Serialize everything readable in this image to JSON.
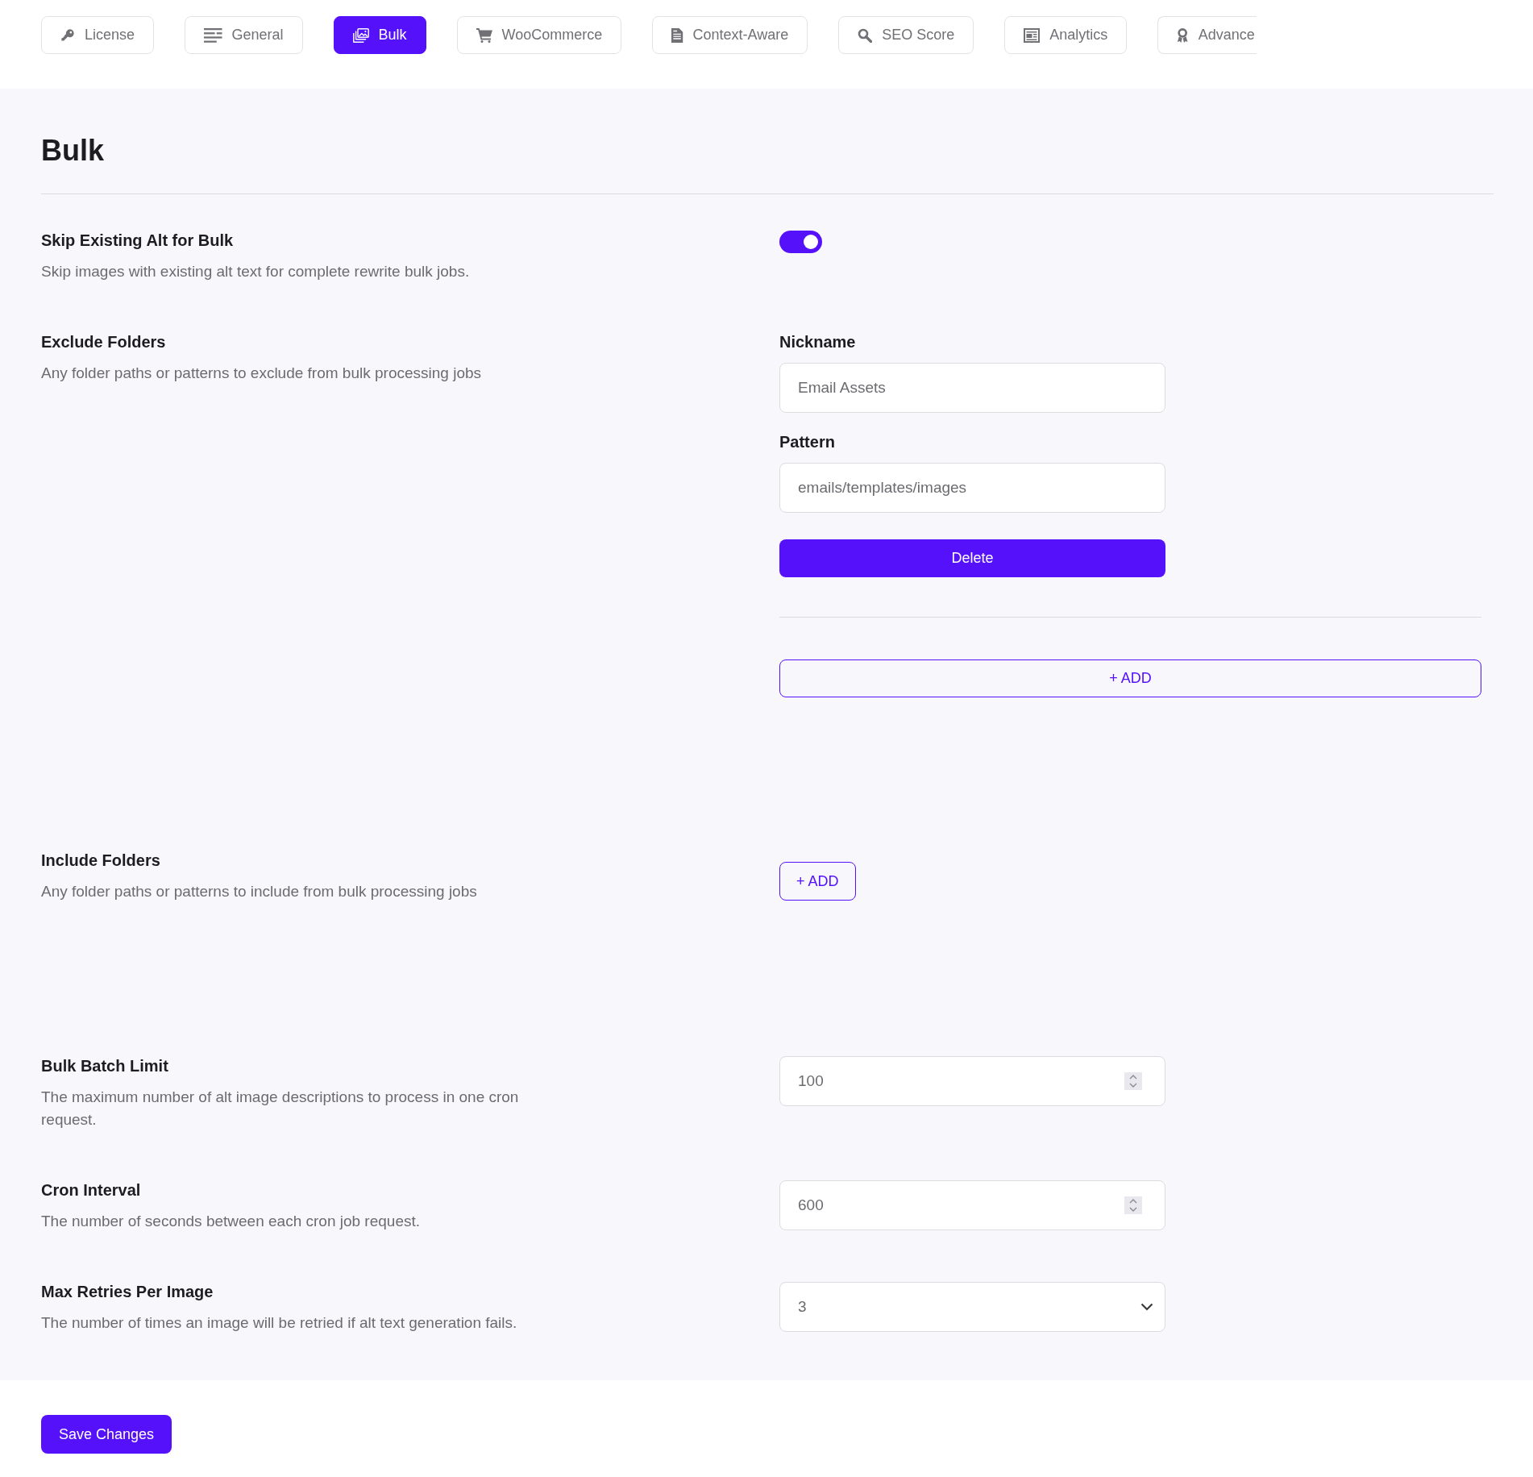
{
  "tabs": [
    {
      "label": "License",
      "selected": false
    },
    {
      "label": "General",
      "selected": false
    },
    {
      "label": "Bulk",
      "selected": true
    },
    {
      "label": "WooCommerce",
      "selected": false
    },
    {
      "label": "Context-Aware",
      "selected": false
    },
    {
      "label": "SEO Score",
      "selected": false
    },
    {
      "label": "Analytics",
      "selected": false
    },
    {
      "label": "Advance",
      "selected": false
    }
  ],
  "page": {
    "title": "Bulk"
  },
  "settings": [
    {
      "kind": "toggle",
      "title": "Skip Existing Alt for Bulk",
      "description": "Skip images with existing alt text for complete rewrite bulk jobs.",
      "on": true
    },
    {
      "kind": "folders",
      "title": "Exclude Folders",
      "description": "Any folder paths or patterns to exclude from bulk processing jobs",
      "entries": [
        {
          "fields": [
            {
              "label": "Nickname",
              "value": "Email Assets"
            },
            {
              "label": "Pattern",
              "value": "emails/templates/images"
            }
          ],
          "delete_button": "Delete"
        }
      ],
      "add_button": "+ ADD"
    },
    {
      "kind": "folders",
      "title": "Include Folders",
      "description": "Any folder paths or patterns to include from bulk processing jobs",
      "add_button": "+ ADD"
    },
    {
      "kind": "number",
      "title": "Bulk Batch Limit",
      "description": "The maximum number of alt image descriptions to process in one cron request.",
      "value": "100"
    },
    {
      "kind": "number",
      "title": "Cron Interval",
      "description": "The number of seconds between each cron job request.",
      "value": "600"
    },
    {
      "kind": "select",
      "title": "Max Retries Per Image",
      "description": "The number of times an image will be retried if alt text generation fails.",
      "value": "3"
    }
  ],
  "save_button": "Save Changes"
}
